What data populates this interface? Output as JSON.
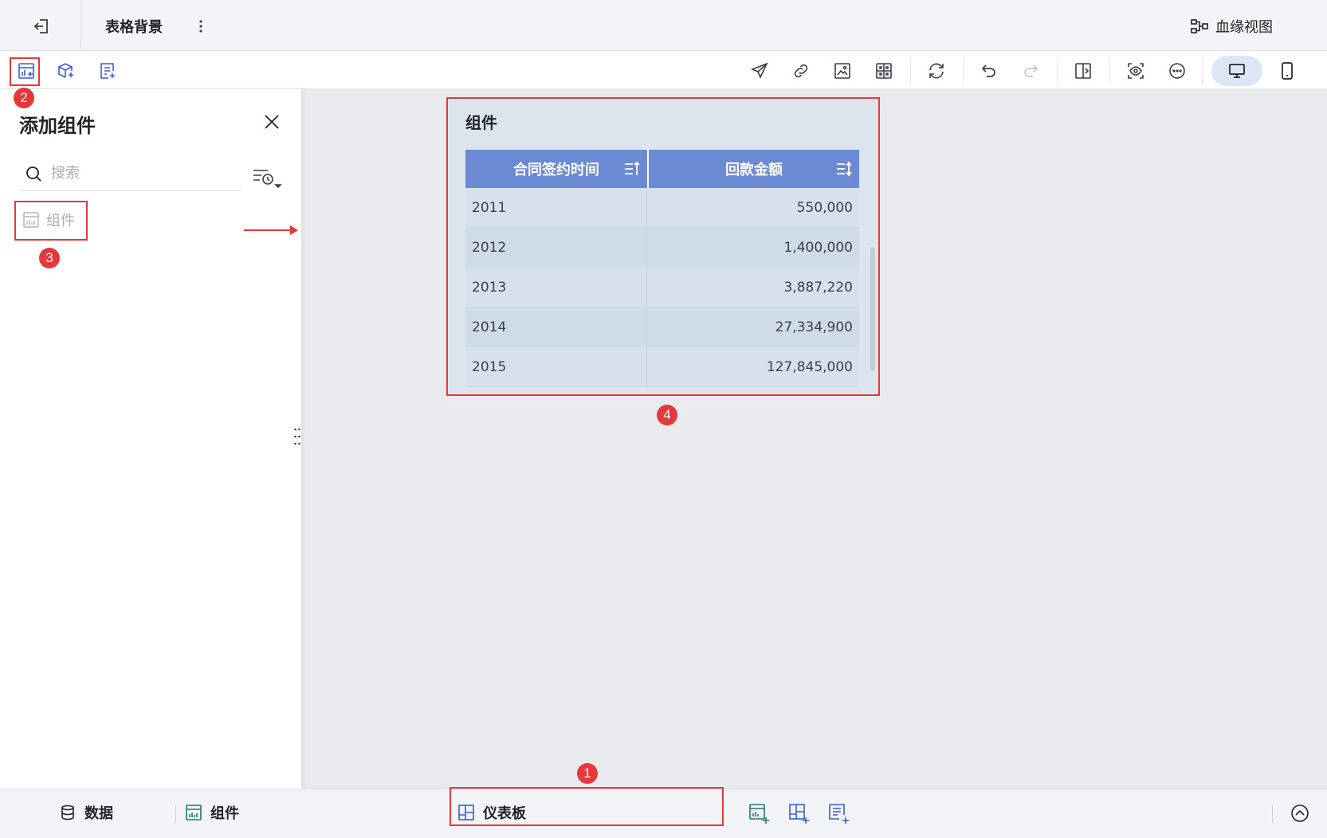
{
  "titlebar": {
    "title": "表格背景",
    "lineage_label": "血缘视图"
  },
  "panel": {
    "title": "添加组件",
    "search": {
      "placeholder": "搜索",
      "value": ""
    },
    "items": [
      {
        "label": "组件"
      }
    ]
  },
  "widget": {
    "title": "组件",
    "columns": [
      "合同签约时间",
      "回款金额"
    ],
    "rows": [
      [
        "2011",
        "550,000"
      ],
      [
        "2012",
        "1,400,000"
      ],
      [
        "2013",
        "3,887,220"
      ],
      [
        "2014",
        "27,334,900"
      ],
      [
        "2015",
        "127,845,000"
      ]
    ]
  },
  "bottombar": {
    "data_label": "数据",
    "component_label": "组件",
    "dashboard_label": "仪表板"
  },
  "annotations": {
    "badges": [
      "1",
      "2",
      "3",
      "4"
    ],
    "color": "#e5383b"
  },
  "colors": {
    "accent": "#3d5bd9",
    "table_header": "#6b8ad3",
    "widget_bg": "#dce5ee"
  }
}
